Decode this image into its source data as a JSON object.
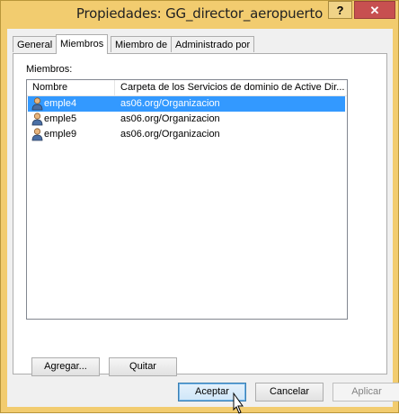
{
  "window": {
    "title": "Propiedades: GG_director_aeropuerto"
  },
  "titlebar": {
    "help_label": "?",
    "close_label": "✕"
  },
  "tabs": [
    {
      "label": "General"
    },
    {
      "label": "Miembros"
    },
    {
      "label": "Miembro de"
    },
    {
      "label": "Administrado por"
    }
  ],
  "members": {
    "label": "Miembros:",
    "columns": [
      "Nombre",
      "Carpeta de los Servicios de dominio de Active Dir..."
    ],
    "rows": [
      {
        "name": "emple4",
        "folder": "as06.org/Organizacion",
        "selected": true
      },
      {
        "name": "emple5",
        "folder": "as06.org/Organizacion",
        "selected": false
      },
      {
        "name": "emple9",
        "folder": "as06.org/Organizacion",
        "selected": false
      }
    ]
  },
  "buttons": {
    "add": "Agregar...",
    "remove": "Quitar",
    "ok": "Aceptar",
    "cancel": "Cancelar",
    "apply": "Aplicar"
  },
  "colors": {
    "titlebar": "#f2cc6f",
    "close": "#c75050",
    "selection": "#3399ff"
  },
  "icons": {
    "row_icon": "user-icon",
    "pointer": "mouse-pointer-icon"
  }
}
